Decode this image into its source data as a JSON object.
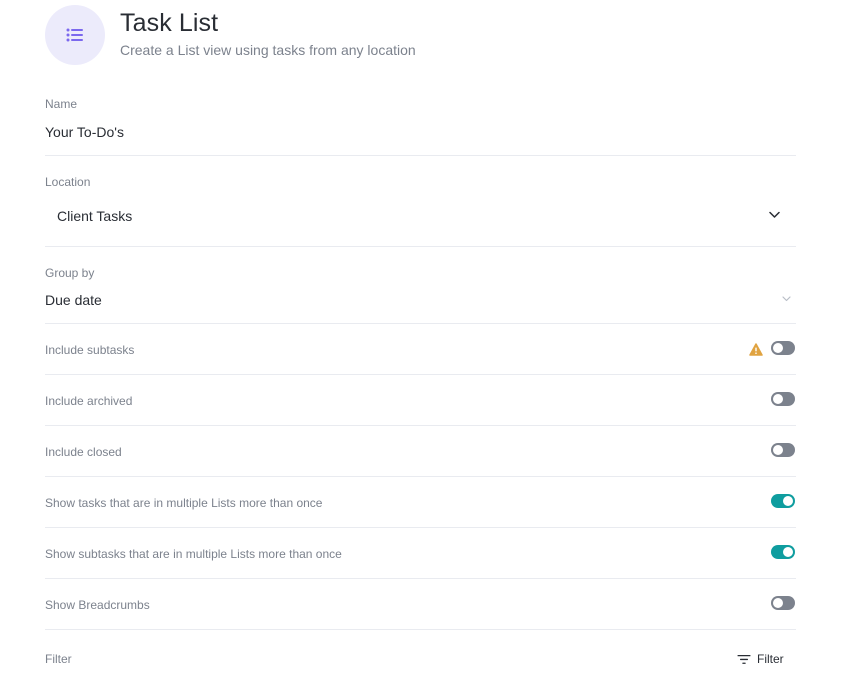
{
  "header": {
    "icon": "list-icon",
    "title": "Task List",
    "subtitle": "Create a List view using tasks from any location"
  },
  "name_field": {
    "label": "Name",
    "value": "Your To-Do's"
  },
  "location_field": {
    "label": "Location",
    "value": "Client Tasks"
  },
  "group_by_field": {
    "label": "Group by",
    "value": "Due date"
  },
  "options": [
    {
      "label": "Include subtasks",
      "enabled": false,
      "warning": true
    },
    {
      "label": "Include archived",
      "enabled": false,
      "warning": false
    },
    {
      "label": "Include closed",
      "enabled": false,
      "warning": false
    },
    {
      "label": "Show tasks that are in multiple Lists more than once",
      "enabled": true,
      "warning": false
    },
    {
      "label": "Show subtasks that are in multiple Lists more than once",
      "enabled": true,
      "warning": false
    },
    {
      "label": "Show Breadcrumbs",
      "enabled": false,
      "warning": false
    }
  ],
  "filter": {
    "label": "Filter",
    "button_label": "Filter"
  },
  "colors": {
    "accent_icon": "#7b68ee",
    "toggle_on": "#0f9d9f",
    "toggle_off": "#7c828d",
    "warning": "#e0a341"
  }
}
